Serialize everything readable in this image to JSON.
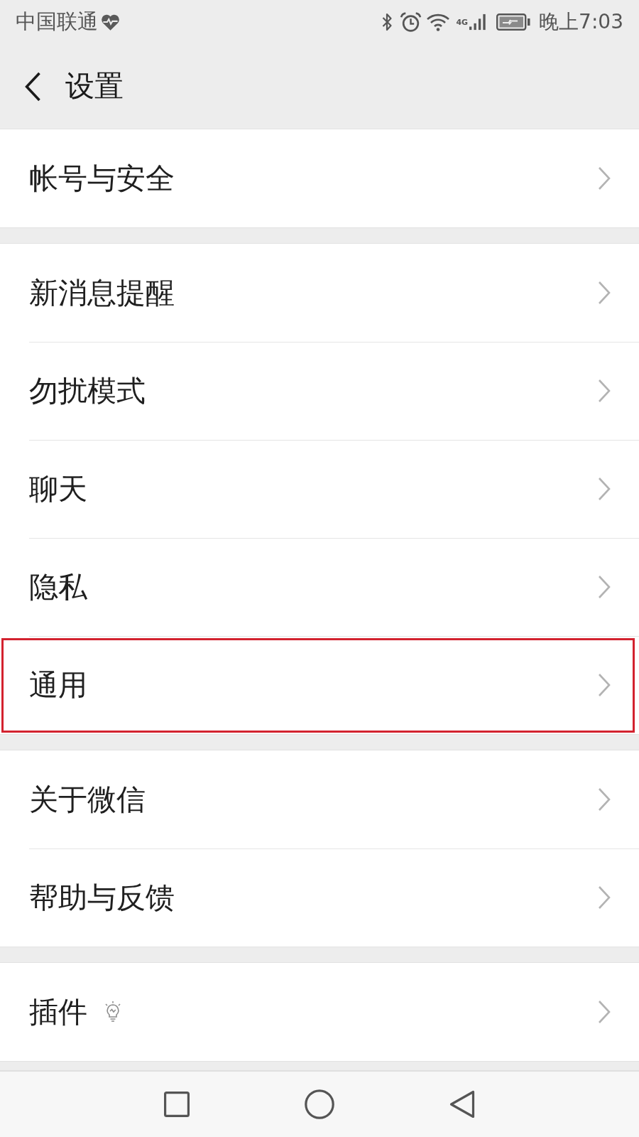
{
  "status_bar": {
    "carrier": "中国联通",
    "network": "4G",
    "time": "晚上7:03"
  },
  "header": {
    "title": "设置"
  },
  "groups": [
    {
      "items": [
        {
          "label": "帐号与安全",
          "highlighted": false,
          "tip_icon": false
        }
      ]
    },
    {
      "items": [
        {
          "label": "新消息提醒",
          "highlighted": false,
          "tip_icon": false
        },
        {
          "label": "勿扰模式",
          "highlighted": false,
          "tip_icon": false
        },
        {
          "label": "聊天",
          "highlighted": false,
          "tip_icon": false
        },
        {
          "label": "隐私",
          "highlighted": false,
          "tip_icon": false
        },
        {
          "label": "通用",
          "highlighted": true,
          "tip_icon": false
        }
      ]
    },
    {
      "items": [
        {
          "label": "关于微信",
          "highlighted": false,
          "tip_icon": false
        },
        {
          "label": "帮助与反馈",
          "highlighted": false,
          "tip_icon": false
        }
      ]
    },
    {
      "items": [
        {
          "label": "插件",
          "highlighted": false,
          "tip_icon": true
        }
      ]
    }
  ]
}
